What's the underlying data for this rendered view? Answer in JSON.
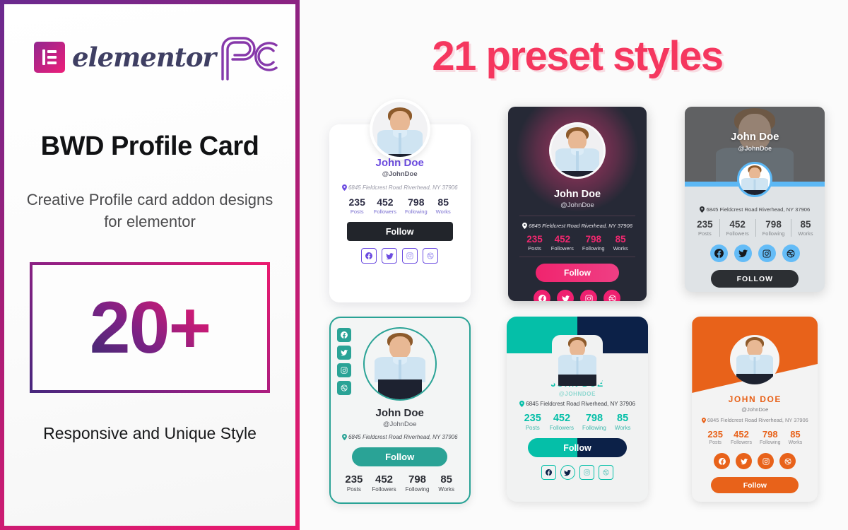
{
  "left": {
    "logos": {
      "elementor_word": "elementor",
      "pc_logo_name": "pc-monogram-logo"
    },
    "title": "BWD Profile Card",
    "subtitle": "Creative Profile card addon designs for elementor",
    "count": "20+",
    "tagline": "Responsive and Unique Style"
  },
  "right": {
    "headline": "21 preset styles"
  },
  "profile": {
    "name": "John Doe",
    "name_upper": "JOHN DOE",
    "handle": "@JohnDoe",
    "handle_upper": "@JOHNDOE",
    "address": "6845 Fieldcrest Road Riverhead, NY 37906",
    "stats": [
      {
        "value": "235",
        "label": "Posts"
      },
      {
        "value": "452",
        "label": "Followers"
      },
      {
        "value": "798",
        "label": "Following"
      },
      {
        "value": "85",
        "label": "Works"
      }
    ],
    "socials": [
      "facebook-icon",
      "twitter-icon",
      "instagram-icon",
      "dribbble-icon"
    ]
  },
  "cards": [
    {
      "id": "card-1-light-purple",
      "follow": "Follow",
      "accent": "#6c4ce0"
    },
    {
      "id": "card-2-dark-pink",
      "follow": "Follow",
      "accent": "#f0246e"
    },
    {
      "id": "card-3-gray-blue",
      "follow": "FOLLOW",
      "accent": "#5cb8f5"
    },
    {
      "id": "card-4-teal-outline",
      "follow": "Follow",
      "accent": "#2aa396"
    },
    {
      "id": "card-5-teal-navy",
      "follow": "Follow",
      "accent": "#05bfa8"
    },
    {
      "id": "card-6-orange",
      "follow": "Follow",
      "accent": "#e8621a"
    }
  ],
  "colors": {
    "frame_gradient_start": "#6a2a8f",
    "frame_gradient_end": "#ec1a6e",
    "headline_pink": "#f5375f",
    "count_gradient_start": "#46277d",
    "count_gradient_end": "#ec1a6e"
  }
}
